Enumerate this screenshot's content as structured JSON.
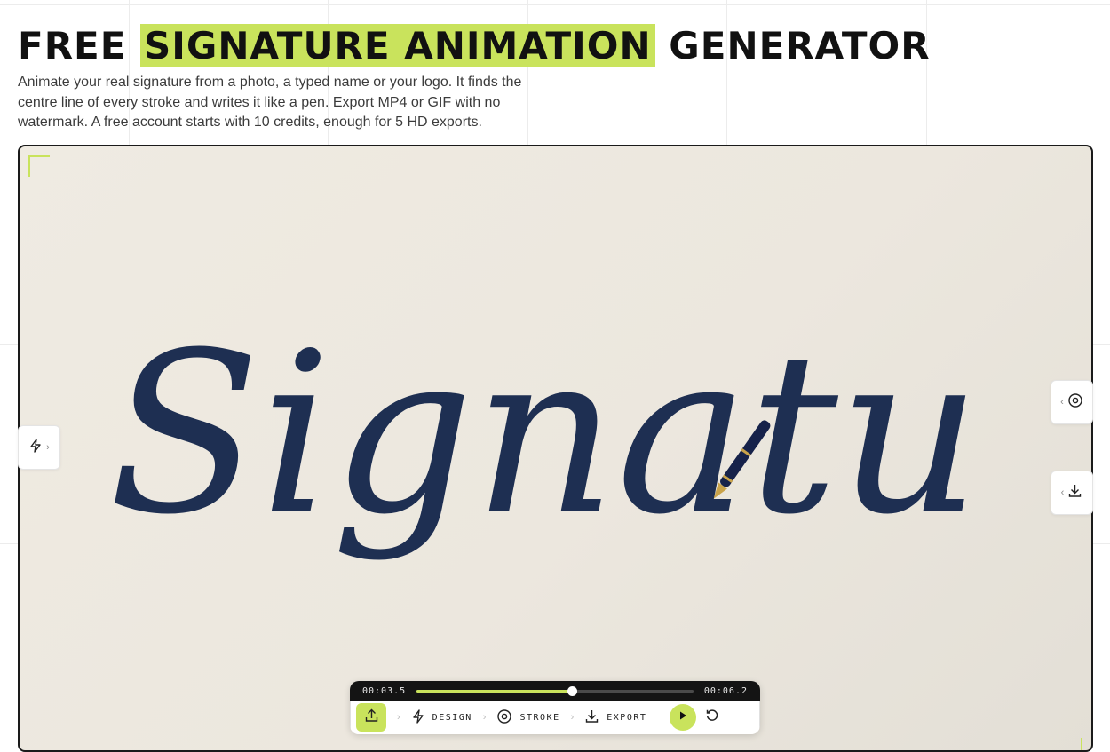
{
  "hero": {
    "title_pre": "FREE",
    "title_highlight": "SIGNATURE ANIMATION",
    "title_post": "GENERATOR",
    "description": "Animate your real signature from a photo, a typed name or your logo. It finds the centre line of every stroke and writes it like a pen. Export MP4 or GIF with no watermark. A free account starts with 10 credits, enough for 5 HD exports."
  },
  "canvas": {
    "signature_text": "Signatu",
    "ink_color": "#1e2f52",
    "accent_color": "#c9e35c"
  },
  "side_tabs": {
    "left_icon": "lightning-icon",
    "right_top_icon": "target-icon",
    "right_bottom_icon": "download-icon"
  },
  "player": {
    "current_time": "00:03.5",
    "total_time": "00:06.2",
    "progress": 0.56,
    "steps": [
      {
        "label": "DESIGN",
        "icon": "lightning-icon"
      },
      {
        "label": "STROKE",
        "icon": "target-icon"
      },
      {
        "label": "EXPORT",
        "icon": "download-icon"
      }
    ]
  }
}
